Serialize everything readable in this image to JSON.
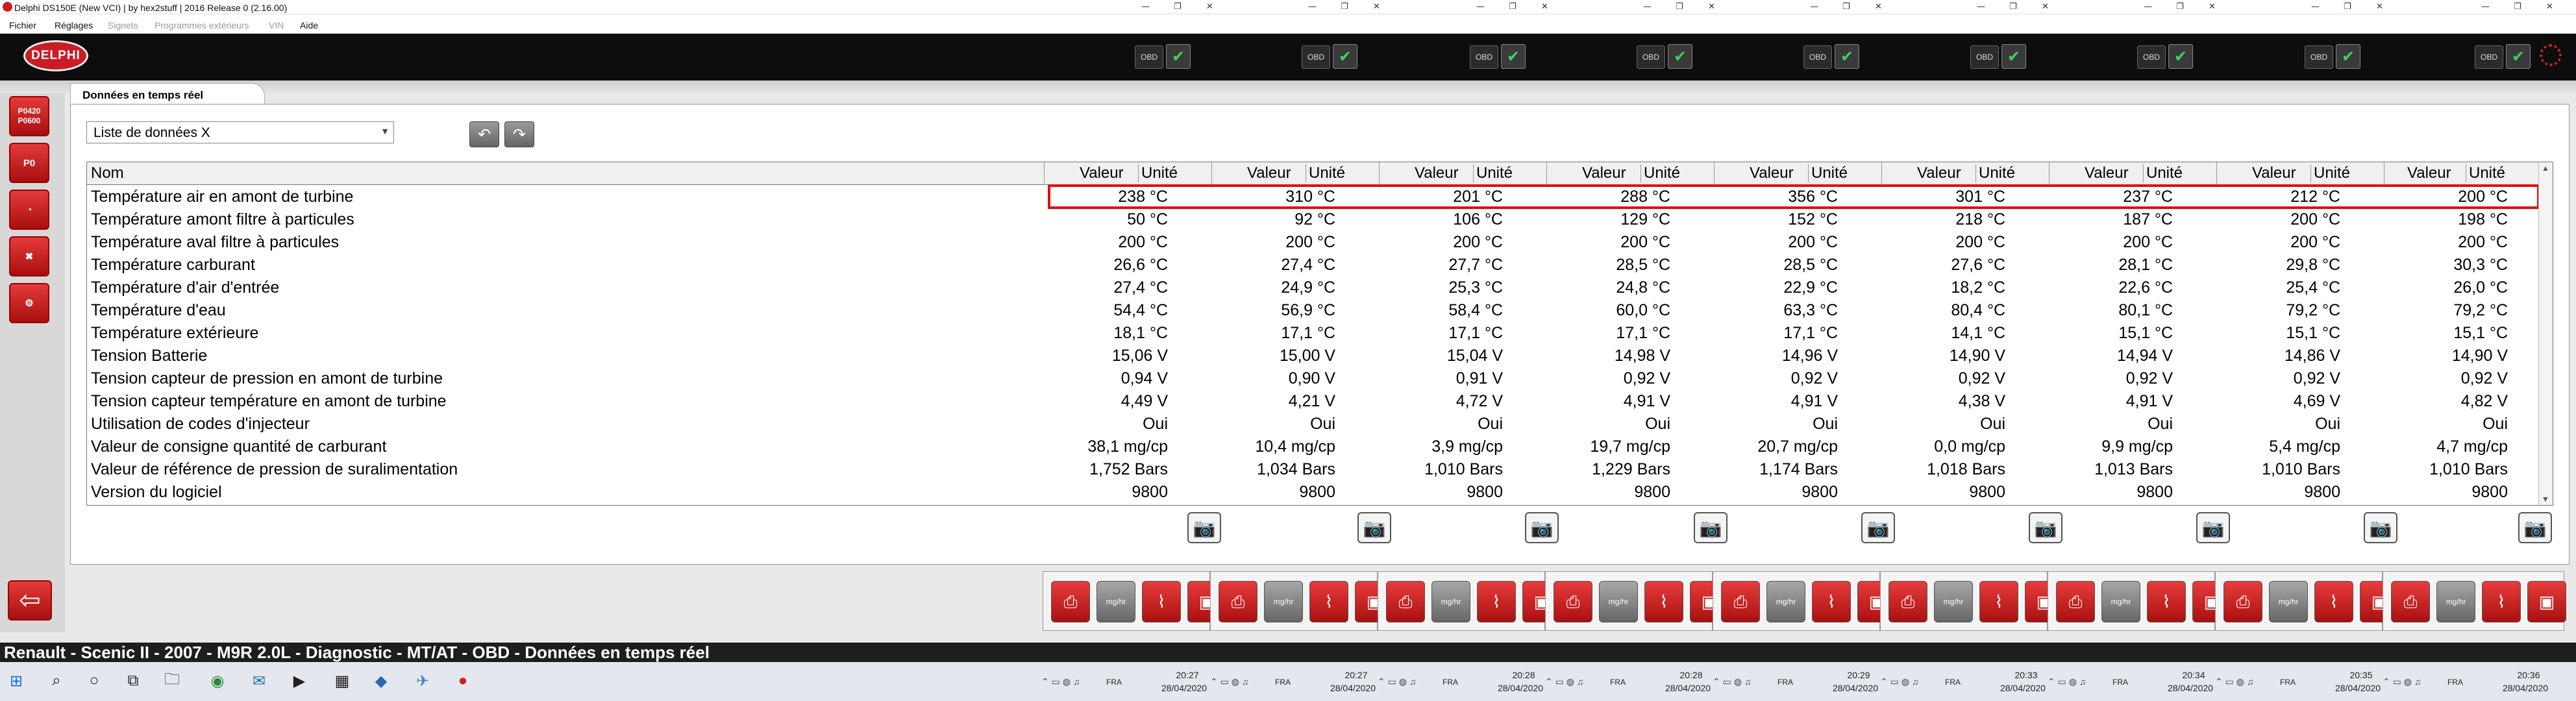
{
  "window": {
    "title": "Delphi DS150E (New VCI) | by hex2stuff | 2016 Release 0 (2.16.00)"
  },
  "menu": {
    "items": [
      "Fichier",
      "Réglages",
      "Signets",
      "Programmes extérieurs",
      "VIN",
      "Aide"
    ],
    "dim": [
      false,
      false,
      true,
      true,
      true,
      false
    ]
  },
  "header": {
    "logo_text": "DELPHI",
    "obd_label": "OBD",
    "check_glyph": "✔"
  },
  "left_toolbar": {
    "btn1": "P0420\nP0600",
    "btn2": "P0",
    "back_glyph": "⇦"
  },
  "tab": {
    "label": "Données en temps réel"
  },
  "dataset_select": {
    "value": "Liste de données X"
  },
  "grid": {
    "header_name": "Nom",
    "header_value": "Valeur",
    "header_unit": "Unité",
    "rows": [
      {
        "name": "Température air en amont de turbine",
        "values": [
          "238 °C",
          "310 °C",
          "201 °C",
          "288 °C",
          "356 °C",
          "301 °C",
          "237 °C",
          "212 °C",
          "200 °C"
        ]
      },
      {
        "name": "Température amont filtre à particules",
        "values": [
          "50 °C",
          "92 °C",
          "106 °C",
          "129 °C",
          "152 °C",
          "218 °C",
          "187 °C",
          "200 °C",
          "198 °C"
        ]
      },
      {
        "name": "Température aval filtre à particules",
        "values": [
          "200 °C",
          "200 °C",
          "200 °C",
          "200 °C",
          "200 °C",
          "200 °C",
          "200 °C",
          "200 °C",
          "200 °C"
        ]
      },
      {
        "name": "Température carburant",
        "values": [
          "26,6 °C",
          "27,4 °C",
          "27,7 °C",
          "28,5 °C",
          "28,5 °C",
          "27,6 °C",
          "28,1 °C",
          "29,8 °C",
          "30,3 °C"
        ]
      },
      {
        "name": "Température d'air d'entrée",
        "values": [
          "27,4 °C",
          "24,9 °C",
          "25,3 °C",
          "24,8 °C",
          "22,9 °C",
          "18,2 °C",
          "22,6 °C",
          "25,4 °C",
          "26,0 °C"
        ]
      },
      {
        "name": "Température d'eau",
        "values": [
          "54,4 °C",
          "56,9 °C",
          "58,4 °C",
          "60,0 °C",
          "63,3 °C",
          "80,4 °C",
          "80,1 °C",
          "79,2 °C",
          "79,2 °C"
        ]
      },
      {
        "name": "Température extérieure",
        "values": [
          "18,1 °C",
          "17,1 °C",
          "17,1 °C",
          "17,1 °C",
          "17,1 °C",
          "14,1 °C",
          "15,1 °C",
          "15,1 °C",
          "15,1 °C"
        ]
      },
      {
        "name": "Tension Batterie",
        "values": [
          "15,06 V",
          "15,00 V",
          "15,04 V",
          "14,98 V",
          "14,96 V",
          "14,90 V",
          "14,94 V",
          "14,86 V",
          "14,90 V"
        ]
      },
      {
        "name": "Tension capteur de pression en amont de turbine",
        "values": [
          "0,94 V",
          "0,90 V",
          "0,91 V",
          "0,92 V",
          "0,92 V",
          "0,92 V",
          "0,92 V",
          "0,92 V",
          "0,92 V"
        ]
      },
      {
        "name": "Tension capteur température en amont de turbine",
        "values": [
          "4,49 V",
          "4,21 V",
          "4,72 V",
          "4,91 V",
          "4,91 V",
          "4,38 V",
          "4,91 V",
          "4,69 V",
          "4,82 V"
        ]
      },
      {
        "name": "Utilisation de codes d'injecteur",
        "values": [
          "Oui",
          "Oui",
          "Oui",
          "Oui",
          "Oui",
          "Oui",
          "Oui",
          "Oui",
          "Oui"
        ]
      },
      {
        "name": "Valeur de consigne quantité de carburant",
        "values": [
          "38,1 mg/cp",
          "10,4 mg/cp",
          "3,9 mg/cp",
          "19,7 mg/cp",
          "20,7 mg/cp",
          "0,0 mg/cp",
          "9,9 mg/cp",
          "5,4 mg/cp",
          "4,7 mg/cp"
        ]
      },
      {
        "name": "Valeur de référence de pression de suralimentation",
        "values": [
          "1,752 Bars",
          "1,034 Bars",
          "1,010 Bars",
          "1,229 Bars",
          "1,174 Bars",
          "1,018 Bars",
          "1,013 Bars",
          "1,010 Bars",
          "1,010 Bars"
        ]
      },
      {
        "name": "Version du logiciel",
        "values": [
          "9800",
          "9800",
          "9800",
          "9800",
          "9800",
          "9800",
          "9800",
          "9800",
          "9800"
        ]
      }
    ]
  },
  "status_bar": {
    "text": "Renault - Scenic II - 2007 - M9R 2.0L - Diagnostic - MT/AT - OBD - Données en temps réel"
  },
  "bottom_toolbar": {
    "mg_label": "mg/hr"
  },
  "taskbar": {
    "lang": "FRA",
    "clocks": [
      {
        "time": "20:27",
        "date": "28/04/2020"
      },
      {
        "time": "20:27",
        "date": "28/04/2020"
      },
      {
        "time": "20:28",
        "date": "28/04/2020"
      },
      {
        "time": "20:28",
        "date": "28/04/2020"
      },
      {
        "time": "20:29",
        "date": "28/04/2020"
      },
      {
        "time": "20:33",
        "date": "28/04/2020"
      },
      {
        "time": "20:34",
        "date": "28/04/2020"
      },
      {
        "time": "20:35",
        "date": "28/04/2020"
      },
      {
        "time": "20:36",
        "date": "28/04/2020"
      }
    ]
  }
}
